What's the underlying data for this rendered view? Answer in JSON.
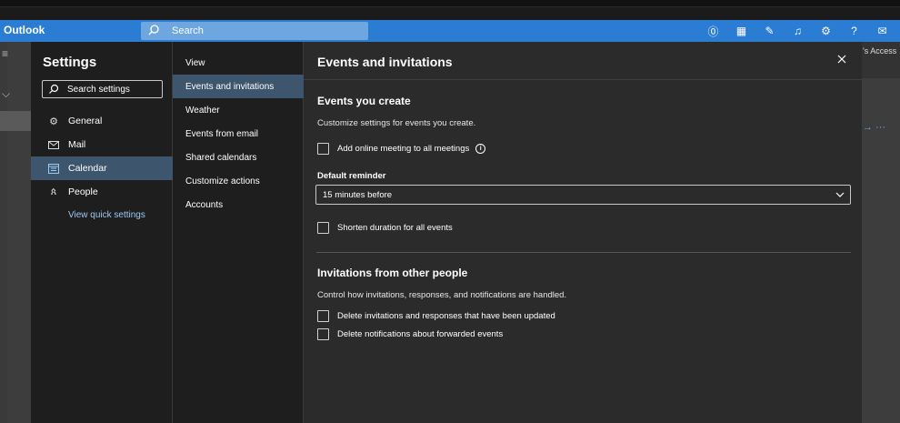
{
  "app": {
    "brand": "Outlook",
    "search_label": "Search",
    "accent": "#2b7cd3"
  },
  "topbar_icons": [
    "skype-icon",
    "teams-icon",
    "todo-icon",
    "bell-icon",
    "gear-icon",
    "help-icon",
    "feedback-icon"
  ],
  "topbar_glyphs": [
    "⓪",
    "▦",
    "✎",
    "♫",
    "⚙",
    "?",
    "✉"
  ],
  "background": {
    "access_text": "'s Access"
  },
  "settings": {
    "title": "Settings",
    "search_label": "Search settings",
    "nav": [
      {
        "label": "General",
        "icon": "gear-icon"
      },
      {
        "label": "Mail",
        "icon": "mail-icon"
      },
      {
        "label": "Calendar",
        "icon": "calendar-icon",
        "selected": true
      },
      {
        "label": "People",
        "icon": "people-icon"
      }
    ],
    "quick_settings_label": "View quick settings"
  },
  "calendar_nav": [
    {
      "label": "View"
    },
    {
      "label": "Events and invitations",
      "selected": true
    },
    {
      "label": "Weather"
    },
    {
      "label": "Events from email"
    },
    {
      "label": "Shared calendars"
    },
    {
      "label": "Customize actions"
    },
    {
      "label": "Accounts"
    }
  ],
  "pane": {
    "title": "Events and invitations",
    "events_section": {
      "heading": "Events you create",
      "description": "Customize settings for events you create.",
      "online_meeting_label": "Add online meeting to all meetings",
      "online_meeting_checked": false,
      "reminder_label": "Default reminder",
      "reminder_value": "15 minutes before",
      "shorten_label": "Shorten duration for all events",
      "shorten_checked": false
    },
    "invitations_section": {
      "heading": "Invitations from other people",
      "description": "Control how invitations, responses, and notifications are handled.",
      "delete_updated_label": "Delete invitations and responses that have been updated",
      "delete_updated_checked": false,
      "delete_forwarded_label": "Delete notifications about forwarded events",
      "delete_forwarded_checked": false
    }
  }
}
